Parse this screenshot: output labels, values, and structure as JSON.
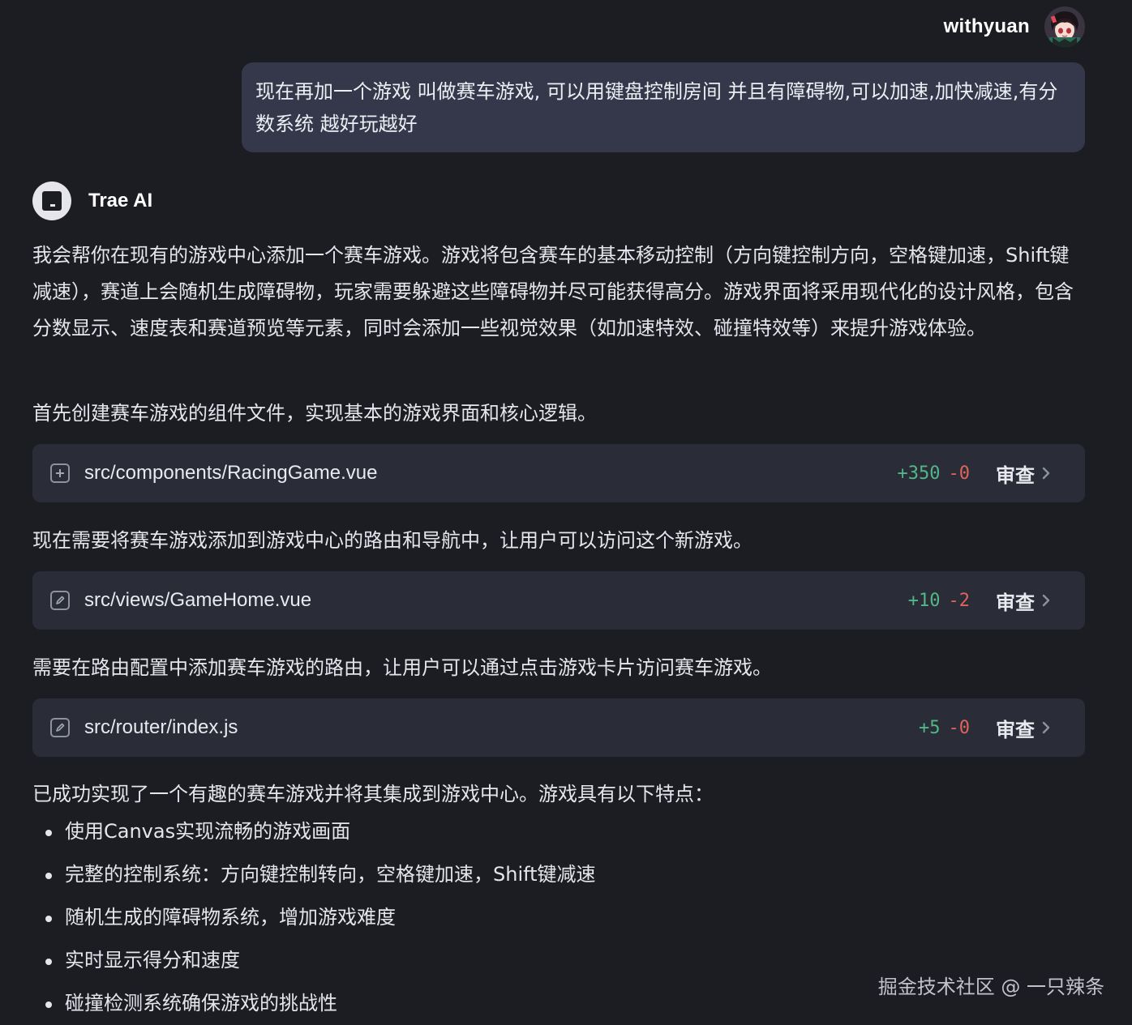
{
  "user": {
    "name": "withyuan",
    "message": "现在再加一个游戏 叫做赛车游戏, 可以用键盘控制房间 并且有障碍物,可以加速,加快减速,有分数系统 越好玩越好"
  },
  "assistant": {
    "name": "Trae AI",
    "intro": "我会帮你在现有的游戏中心添加一个赛车游戏。游戏将包含赛车的基本移动控制（方向键控制方向，空格键加速，Shift键减速），赛道上会随机生成障碍物，玩家需要躲避这些障碍物并尽可能获得高分。游戏界面将采用现代化的设计风格，包含分数显示、速度表和赛道预览等元素，同时会添加一些视觉效果（如加速特效、碰撞特效等）来提升游戏体验。",
    "step1": "首先创建赛车游戏的组件文件，实现基本的游戏界面和核心逻辑。",
    "step2": "现在需要将赛车游戏添加到游戏中心的路由和导航中，让用户可以访问这个新游戏。",
    "step3": "需要在路由配置中添加赛车游戏的路由，让用户可以通过点击游戏卡片访问赛车游戏。",
    "summary": "已成功实现了一个有趣的赛车游戏并将其集成到游戏中心。游戏具有以下特点：",
    "features": [
      "使用Canvas实现流畅的游戏画面",
      "完整的控制系统：方向键控制转向，空格键加速，Shift键减速",
      "随机生成的障碍物系统，增加游戏难度",
      "实时显示得分和速度",
      "碰撞检测系统确保游戏的挑战性"
    ]
  },
  "files": [
    {
      "path": "src/components/RacingGame.vue",
      "added": "+350",
      "removed": "-0",
      "icon": "plus-icon",
      "review": "审查"
    },
    {
      "path": "src/views/GameHome.vue",
      "added": "+10",
      "removed": "-2",
      "icon": "edit-icon",
      "review": "审查"
    },
    {
      "path": "src/router/index.js",
      "added": "+5",
      "removed": "-0",
      "icon": "edit-icon",
      "review": "审查"
    }
  ],
  "watermark": "掘金技术社区 @ 一只辣条",
  "colors": {
    "background": "#1c1d23",
    "user_bubble": "#34384a",
    "file_card": "#2a2c37",
    "diff_added": "#52b788",
    "diff_removed": "#e0635c"
  }
}
